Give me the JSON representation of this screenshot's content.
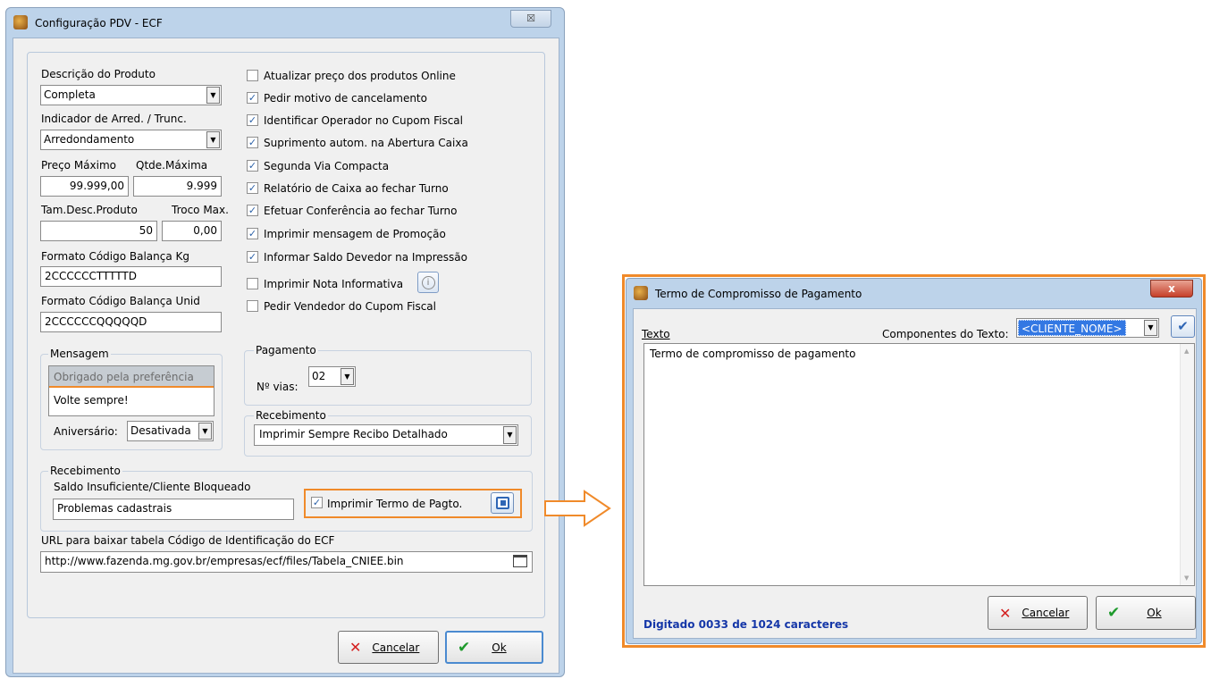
{
  "dlg1": {
    "title": "Configuração PDV - ECF",
    "close_glyph": "☒",
    "descricao_label": "Descrição do Produto",
    "descricao_value": "Completa",
    "indicador_label": "Indicador de Arred. / Trunc.",
    "indicador_value": "Arredondamento",
    "preco_max_label": "Preço Máximo",
    "qtde_max_label": "Qtde.Máxima",
    "preco_max_value": "99.999,00",
    "qtde_max_value": "9.999",
    "tam_desc_label": "Tam.Desc.Produto",
    "troco_max_label": "Troco Max.",
    "tam_desc_value": "50",
    "troco_max_value": "0,00",
    "formato_kg_label": "Formato Código Balança Kg",
    "formato_kg_value": "2CCCCCCTTTTTD",
    "formato_unid_label": "Formato Código Balança Unid",
    "formato_unid_value": "2CCCCCCQQQQQD",
    "checkboxes": [
      {
        "label": "Atualizar preço dos produtos Online",
        "checked": false
      },
      {
        "label": "Pedir motivo de cancelamento",
        "checked": true
      },
      {
        "label": "Identificar Operador no Cupom Fiscal",
        "checked": true
      },
      {
        "label": "Suprimento autom. na Abertura Caixa",
        "checked": true
      },
      {
        "label": "Segunda Via Compacta",
        "checked": true
      },
      {
        "label": "Relatório de Caixa ao fechar Turno",
        "checked": true
      },
      {
        "label": "Efetuar Conferência ao fechar Turno",
        "checked": true
      },
      {
        "label": "Imprimir mensagem de Promoção",
        "checked": true
      },
      {
        "label": "Informar Saldo Devedor na Impressão",
        "checked": true
      },
      {
        "label": "Imprimir Nota Informativa",
        "checked": false
      },
      {
        "label": "Pedir Vendedor do Cupom Fiscal",
        "checked": false
      }
    ],
    "mensagem_title": "Mensagem",
    "mensagem_line1": "Obrigado pela preferência",
    "mensagem_line2": "Volte sempre!",
    "aniversario_label": "Aniversário:",
    "aniversario_value": "Desativada",
    "pagamento_title": "Pagamento",
    "vias_label": "Nº vias:",
    "vias_value": "02",
    "recebimento_title": "Recebimento",
    "recebimento_value": "Imprimir Sempre Recibo Detalhado",
    "receb2_title": "Recebimento",
    "saldo_label": "Saldo Insuficiente/Cliente Bloqueado",
    "saldo_value": "Problemas cadastrais",
    "termo_checkbox_label": "Imprimir Termo de Pagto.",
    "url_label": "URL para baixar tabela Código de Identificação do ECF",
    "url_value": "http://www.fazenda.mg.gov.br/empresas/ecf/files/Tabela_CNIEE.bin",
    "cancelar_label": "Cancelar",
    "ok_label": "Ok"
  },
  "dlg2": {
    "title": "Termo de Compromisso de Pagamento",
    "close_glyph": "x",
    "texto_label": "Texto",
    "componentes_label": "Componentes do Texto:",
    "componentes_value": "<CLIENTE_NOME>",
    "textarea_value": "Termo de compromisso de pagamento",
    "status_text": "Digitado 0033 de 1024 caracteres",
    "cancelar_label": "Cancelar",
    "ok_label": "Ok"
  },
  "colors": {
    "highlight": "#f08a2a",
    "status_blue": "#1537a8",
    "selection": "#3378e3"
  }
}
